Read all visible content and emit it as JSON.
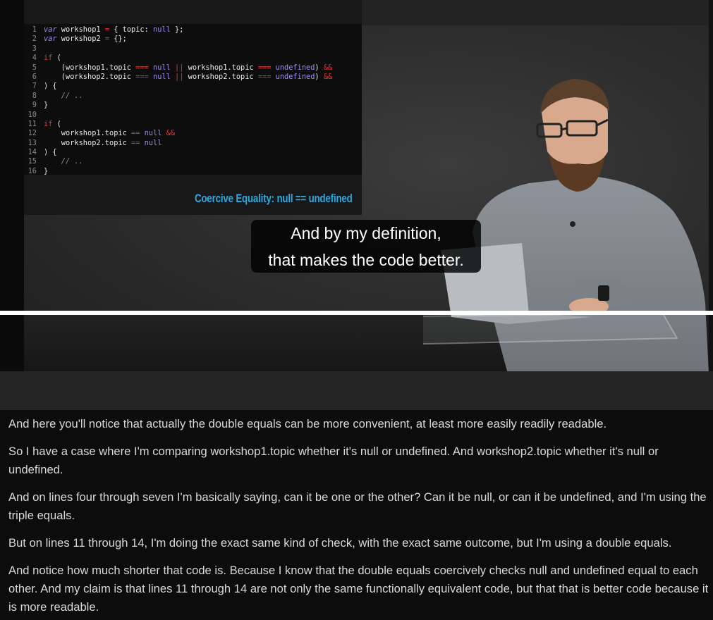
{
  "video": {
    "code_lines": [
      [
        {
          "t": "var",
          "c": "kw-var"
        },
        {
          "t": " workshop1 "
        },
        {
          "t": "=",
          "c": "op"
        },
        {
          "t": " { topic: "
        },
        {
          "t": "null",
          "c": "val"
        },
        {
          "t": " };"
        }
      ],
      [
        {
          "t": "var",
          "c": "kw-var"
        },
        {
          "t": " workshop2 "
        },
        {
          "t": "=",
          "c": "op"
        },
        {
          "t": " {};"
        }
      ],
      [],
      [
        {
          "t": "if",
          "c": "kw"
        },
        {
          "t": " ("
        }
      ],
      [
        {
          "t": "    (workshop1.topic "
        },
        {
          "t": "===",
          "c": "op"
        },
        {
          "t": " "
        },
        {
          "t": "null",
          "c": "val"
        },
        {
          "t": " "
        },
        {
          "t": "||",
          "c": "op"
        },
        {
          "t": " workshop1.topic "
        },
        {
          "t": "===",
          "c": "op"
        },
        {
          "t": " "
        },
        {
          "t": "undefined",
          "c": "val"
        },
        {
          "t": ") "
        },
        {
          "t": "&&",
          "c": "op"
        }
      ],
      [
        {
          "t": "    (workshop2.topic "
        },
        {
          "t": "===",
          "c": "op"
        },
        {
          "t": " "
        },
        {
          "t": "null",
          "c": "val"
        },
        {
          "t": " "
        },
        {
          "t": "||",
          "c": "op"
        },
        {
          "t": " workshop2.topic "
        },
        {
          "t": "===",
          "c": "op"
        },
        {
          "t": " "
        },
        {
          "t": "undefined",
          "c": "val"
        },
        {
          "t": ") "
        },
        {
          "t": "&&",
          "c": "op"
        }
      ],
      [
        {
          "t": ") {"
        }
      ],
      [
        {
          "t": "    // ..",
          "c": "cm"
        }
      ],
      [
        {
          "t": "}"
        }
      ],
      [],
      [
        {
          "t": "if",
          "c": "kw"
        },
        {
          "t": " ("
        }
      ],
      [
        {
          "t": "    workshop1.topic "
        },
        {
          "t": "==",
          "c": "op"
        },
        {
          "t": " "
        },
        {
          "t": "null",
          "c": "val"
        },
        {
          "t": " "
        },
        {
          "t": "&&",
          "c": "op"
        }
      ],
      [
        {
          "t": "    workshop2.topic "
        },
        {
          "t": "==",
          "c": "op"
        },
        {
          "t": " "
        },
        {
          "t": "null",
          "c": "val"
        }
      ],
      [
        {
          "t": ") {"
        }
      ],
      [
        {
          "t": "    // ..",
          "c": "cm"
        }
      ],
      [
        {
          "t": "}"
        }
      ]
    ],
    "slide_caption": "Coercive Equality: null == undefined",
    "subtitle_line1": "And by my definition,",
    "subtitle_line2": "that makes the code better.",
    "progress_fraction": 1.0
  },
  "transcript": {
    "paragraphs": [
      "And here you'll notice that actually the double equals can be more convenient, at least more easily readily readable.",
      "So I have a case where I'm comparing workshop1.topic whether it's null or undefined. And workshop2.topic whether it's null or undefined.",
      "And on lines four through seven I'm basically saying, can it be one or the other? Can it be null, or can it be undefined, and I'm using the triple equals.",
      "But on lines 11 through 14, I'm doing the exact same kind of check, with the exact same outcome, but I'm using a double equals.",
      "And notice how much shorter that code is. Because I know that the double equals coercively checks null and undefined equal to each other. And my claim is that lines 11 through 14 are not only the same functionally equivalent code, but that that is better code because it is more readable."
    ]
  }
}
